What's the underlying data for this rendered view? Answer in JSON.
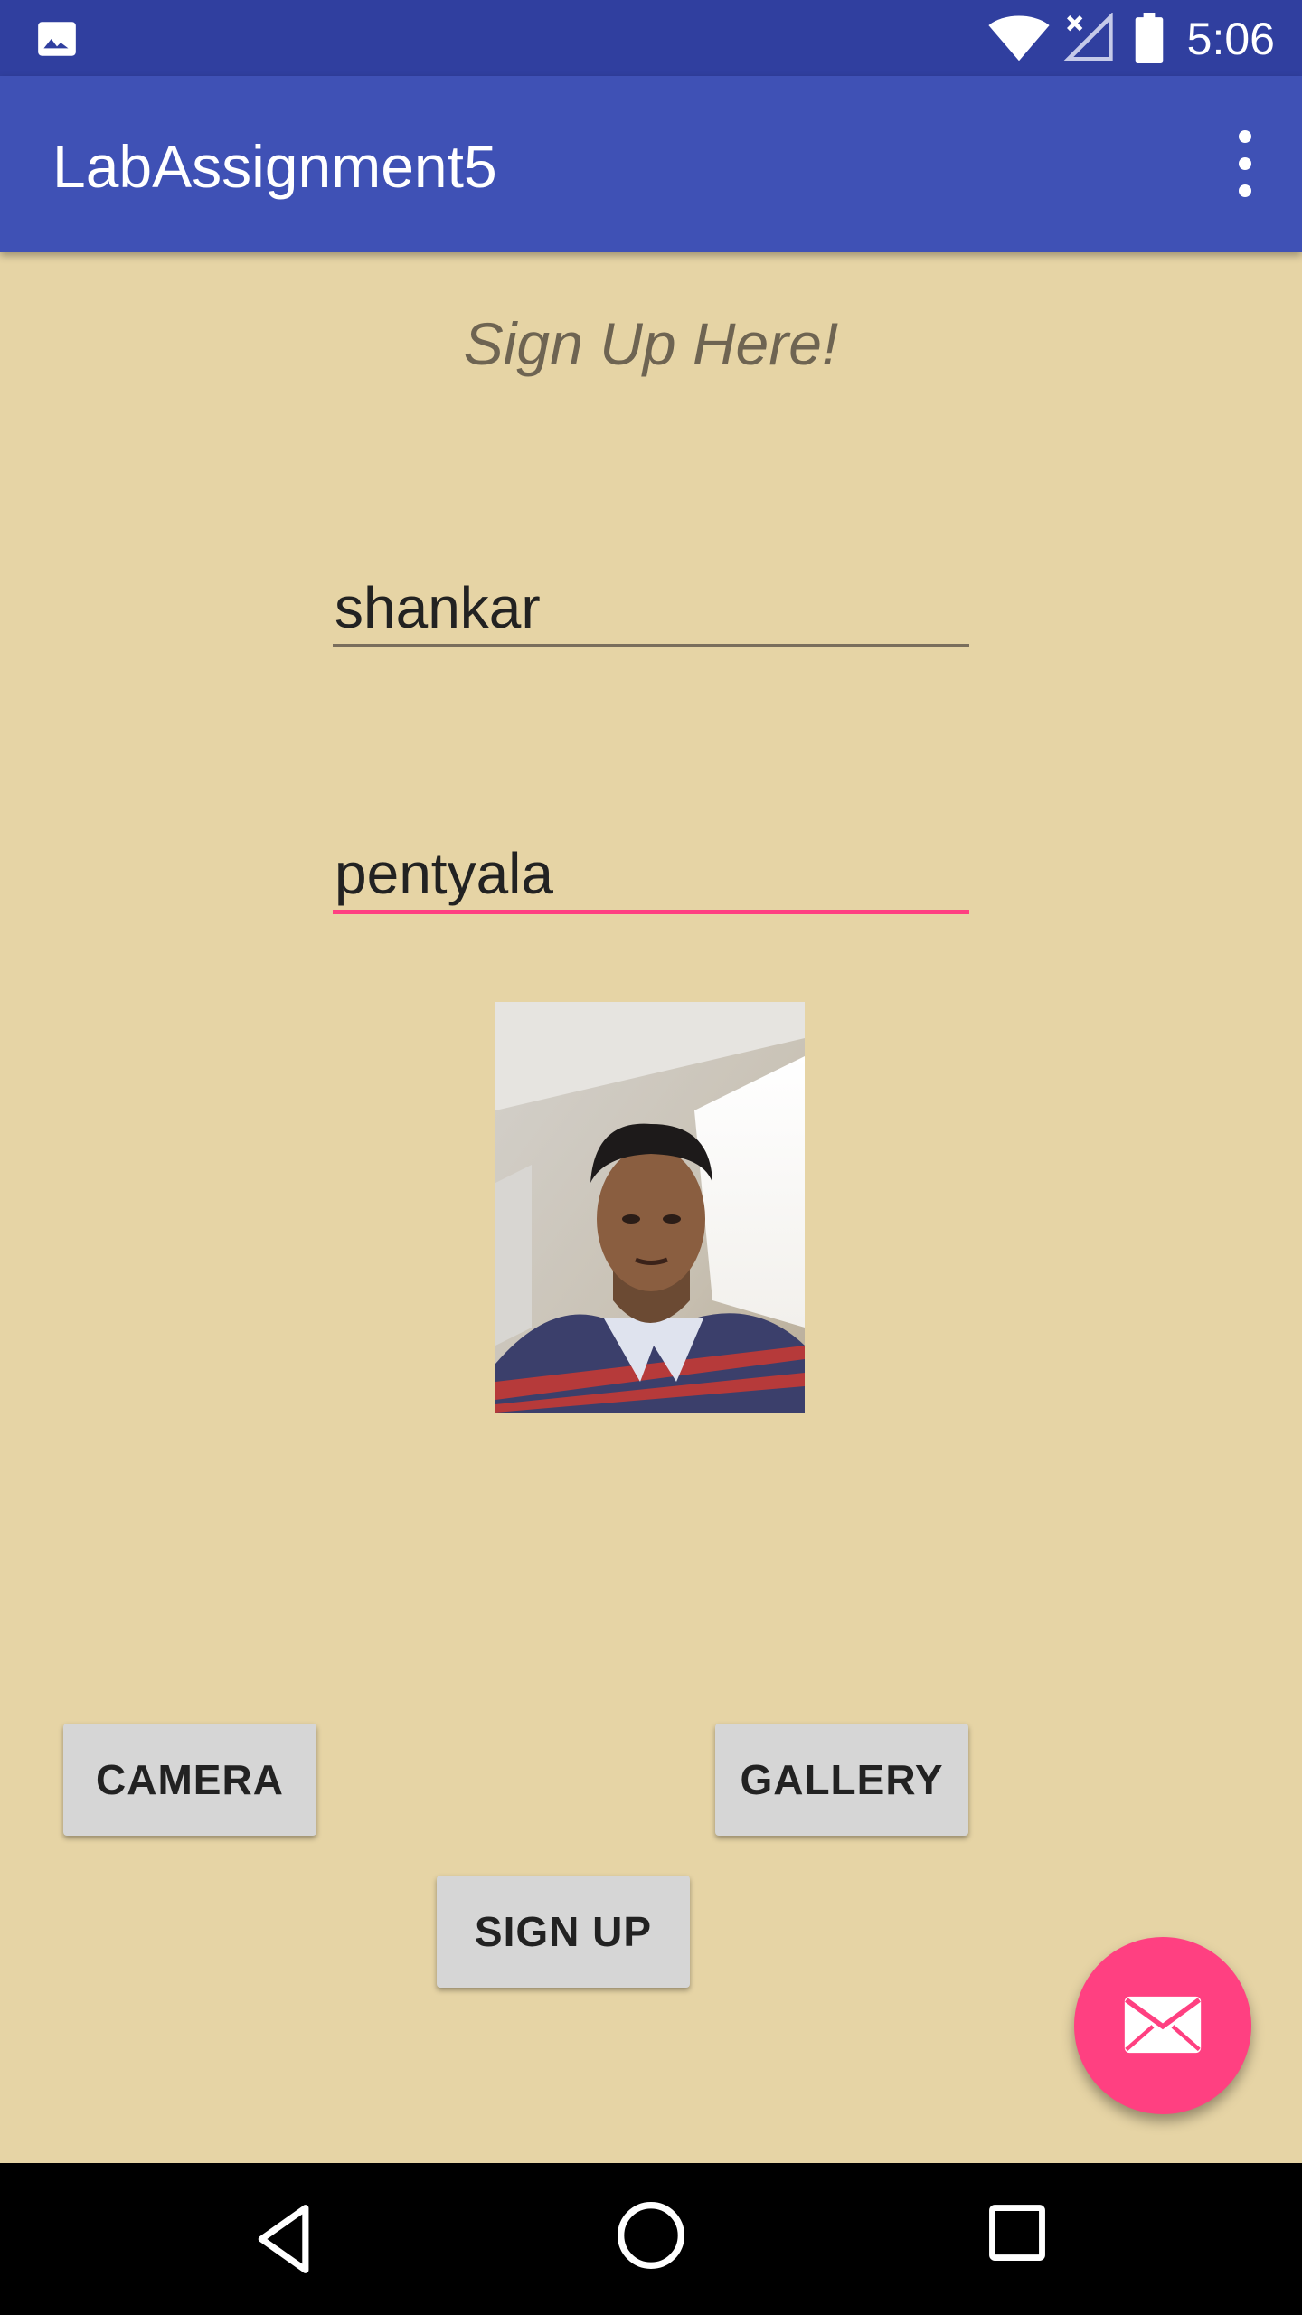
{
  "status_bar": {
    "time": "5:06",
    "notification_icon": "image-icon",
    "icons": [
      "wifi-icon",
      "signal-icon",
      "battery-icon"
    ]
  },
  "app_bar": {
    "title": "LabAssignment5",
    "menu_icon": "overflow-menu-icon"
  },
  "form": {
    "heading": "Sign Up Here!",
    "first_name_value": "shankar",
    "last_name_value": "pentyala"
  },
  "buttons": {
    "camera": "CAMERA",
    "gallery": "GALLERY",
    "signup": "SIGN UP"
  },
  "fab": {
    "icon": "email-icon"
  },
  "nav_bar": {
    "icons": [
      "back-icon",
      "home-icon",
      "recents-icon"
    ]
  },
  "colors": {
    "background": "#e6d4a5",
    "app_bar": "#3f51b5",
    "status_bar": "#303f9f",
    "accent": "#ff4081"
  }
}
